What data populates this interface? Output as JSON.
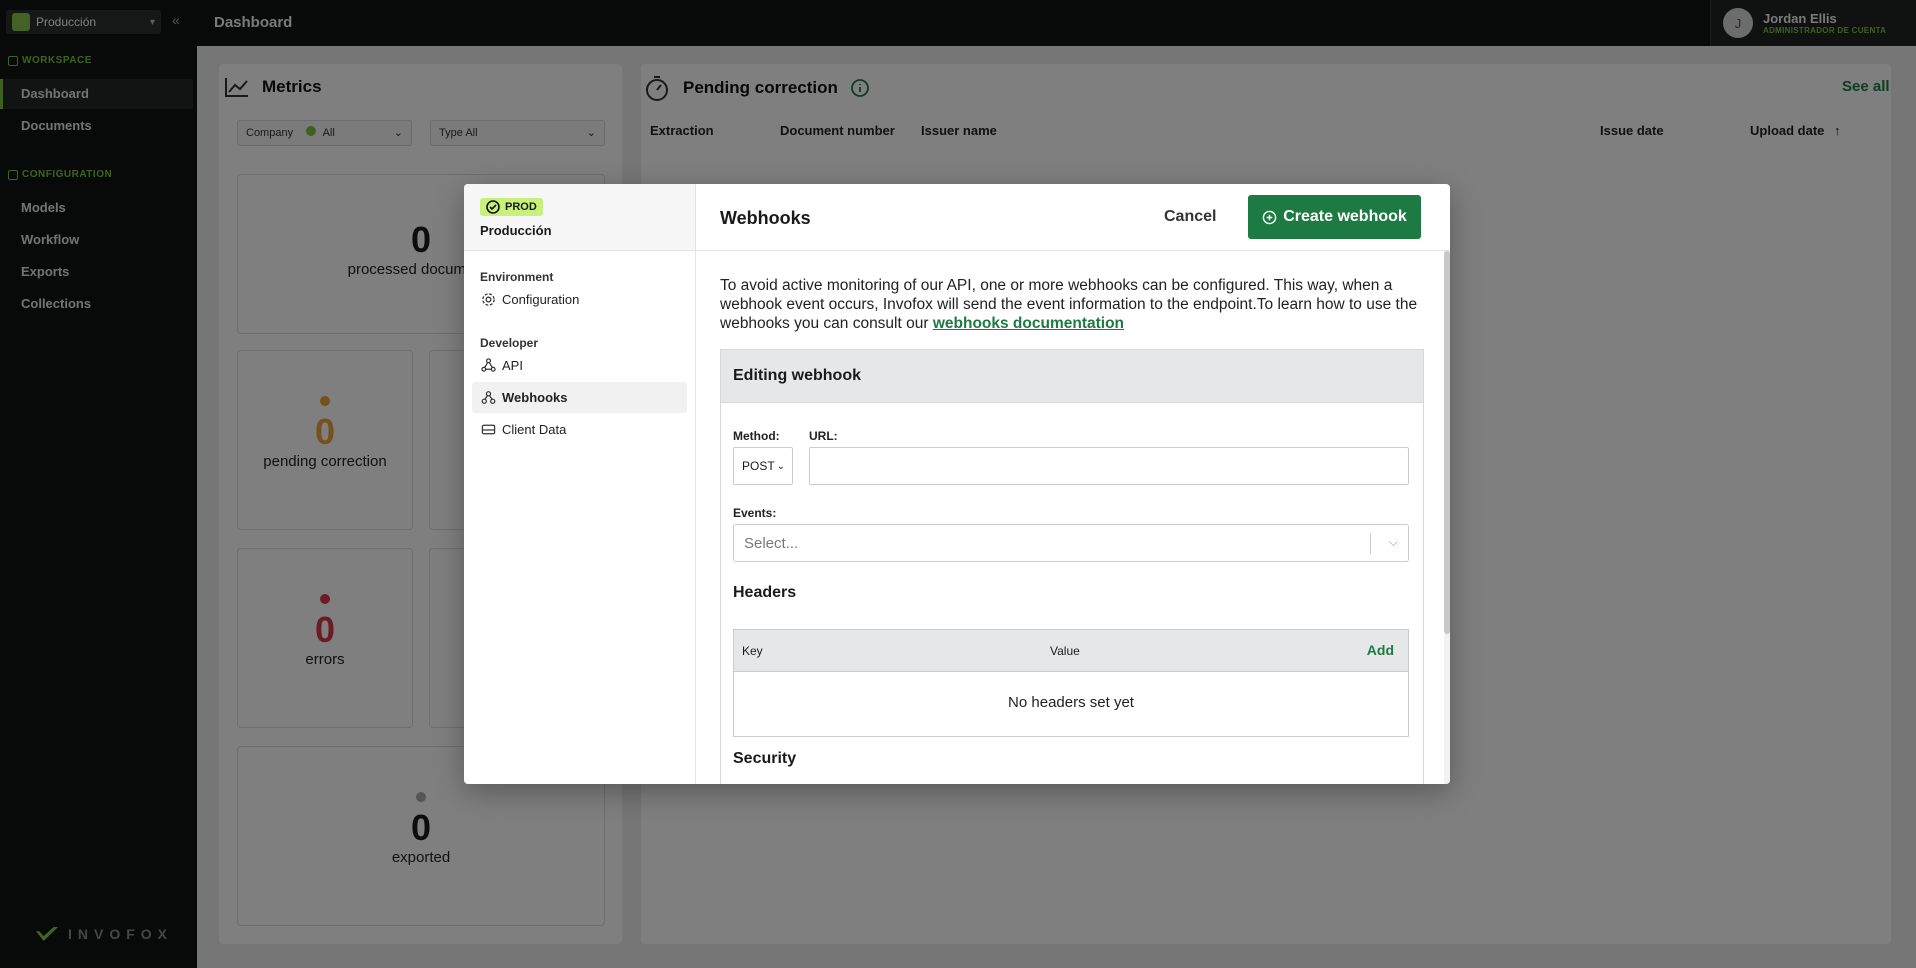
{
  "app": {
    "workspace_selector": "Producción",
    "page_title": "Dashboard",
    "brand": "INVOFOX",
    "sections": {
      "workspace": "WORKSPACE",
      "configuration": "CONFIGURATION"
    },
    "nav": {
      "dashboard": "Dashboard",
      "documents": "Documents",
      "models": "Models",
      "workflow": "Workflow",
      "exports": "Exports",
      "collections": "Collections"
    },
    "user": {
      "initial": "J",
      "name": "Jordan Ellis",
      "role": "ADMINISTRADOR DE CUENTA"
    }
  },
  "dashboard": {
    "metrics_title": "Metrics",
    "company_filter_label": "Company",
    "company_filter_value": "All",
    "type_filter_label": "Type",
    "type_filter_value": "All",
    "cards": {
      "processed": {
        "value": "0",
        "label": "processed documents"
      },
      "pending": {
        "value": "0",
        "label": "pending correction"
      },
      "errors": {
        "value": "0",
        "label": "errors"
      },
      "exported": {
        "value": "0",
        "label": "exported"
      }
    },
    "pending_title": "Pending correction",
    "see_all": "See all",
    "table_headers": [
      "Extraction",
      "Document number",
      "Issuer name",
      "Issue date",
      "Upload date"
    ]
  },
  "modal": {
    "env_badge": "PROD",
    "env_name": "Producción",
    "groups": {
      "environment": "Environment",
      "developer": "Developer"
    },
    "menu": {
      "configuration": "Configuration",
      "api": "API",
      "webhooks": "Webhooks",
      "client_data": "Client Data"
    },
    "title": "Webhooks",
    "cancel": "Cancel",
    "create": "Create webhook",
    "intro_text": "To avoid active monitoring of our API, one or more webhooks can be configured. This way, when a webhook event occurs, Invofox will send the event information to the endpoint.To learn how to use the webhooks you can consult our ",
    "intro_link": "webhooks documentation",
    "editing_title": "Editing webhook",
    "method_label": "Method:",
    "method_value": "POST",
    "url_label": "URL:",
    "url_value": "",
    "events_label": "Events:",
    "events_placeholder": "Select...",
    "headers_title": "Headers",
    "headers_key": "Key",
    "headers_value": "Value",
    "headers_add": "Add",
    "headers_empty": "No headers set yet",
    "security_title": "Security"
  },
  "colors": {
    "accent_green": "#1e7a43",
    "brand_lime": "#8bc34a",
    "pending_orange": "#e8a23a",
    "error_red": "#d9364a"
  }
}
